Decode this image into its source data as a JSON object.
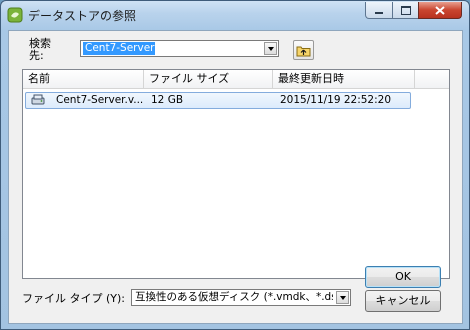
{
  "window": {
    "title": "データストアの参照"
  },
  "search": {
    "label_line1": "検索",
    "label_line2": "先:",
    "location": "Cent7-Server"
  },
  "table": {
    "columns": [
      "名前",
      "ファイル サイズ",
      "最終更新日時"
    ],
    "rows": [
      {
        "name": "Cent7-Server.v...",
        "size": "12 GB",
        "modified": "2015/11/19 22:52:20",
        "icon": "virtual-disk-icon"
      }
    ]
  },
  "filetype": {
    "label": "ファイル タイプ (Y):",
    "value": "互換性のある仮想ディスク (*.vmdk、*.dsk、..."
  },
  "buttons": {
    "ok": "OK",
    "cancel": "キャンセル"
  },
  "colors": {
    "selection": "#3399ff",
    "row_highlight": "#dcebfc",
    "titlebar": "#b9d3ec",
    "close_button": "#c9452f"
  }
}
